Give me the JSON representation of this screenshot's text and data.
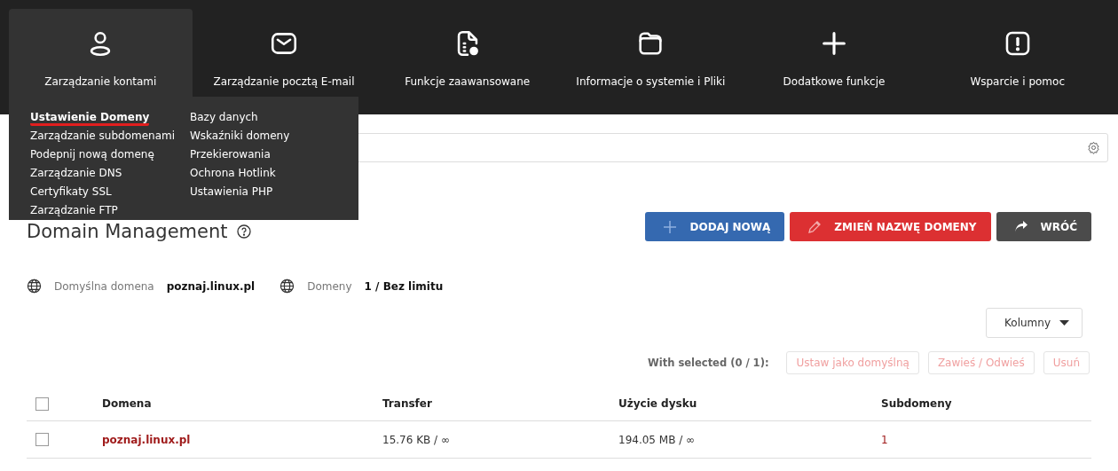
{
  "nav": [
    {
      "label": "Zarządzanie kontami",
      "selected": true
    },
    {
      "label": "Zarządzanie pocztą E-mail",
      "selected": false
    },
    {
      "label": "Funkcje zaawansowane",
      "selected": false
    },
    {
      "label": "Informacje o systemie i Pliki",
      "selected": false
    },
    {
      "label": "Dodatkowe funkcje",
      "selected": false
    },
    {
      "label": "Wsparcie i pomoc",
      "selected": false
    }
  ],
  "menu": {
    "columns": [
      [
        {
          "label": "Ustawienie Domeny",
          "selected": true
        },
        {
          "label": "Zarządzanie subdomenami",
          "selected": false
        },
        {
          "label": "Podepnij nową domenę",
          "selected": false
        },
        {
          "label": "Zarządzanie DNS",
          "selected": false
        },
        {
          "label": "Certyfikaty SSL",
          "selected": false
        },
        {
          "label": "Zarządzanie FTP",
          "selected": false
        }
      ],
      [
        {
          "label": "Bazy danych",
          "selected": false
        },
        {
          "label": "Wskaźniki domeny",
          "selected": false
        },
        {
          "label": "Przekierowania",
          "selected": false
        },
        {
          "label": "Ochrona Hotlink",
          "selected": false
        },
        {
          "label": "Ustawienia PHP",
          "selected": false
        }
      ]
    ]
  },
  "title": "Domain Management",
  "actions": [
    {
      "label": "DODAJ NOWĄ",
      "kind": "add"
    },
    {
      "label": "ZMIEŃ NAZWĘ DOMENY",
      "kind": "rename"
    },
    {
      "label": "WRÓĆ",
      "kind": "back"
    }
  ],
  "stats": [
    {
      "label": "Domyślna domena",
      "value": "poznaj.linux.pl"
    },
    {
      "label": "Domeny",
      "value": "1 / Bez limitu"
    }
  ],
  "columns_button": "Kolumny",
  "bulk": {
    "label": "With selected (0 / 1):",
    "actions": [
      {
        "label": "Ustaw jako domyślną",
        "disabled": true
      },
      {
        "label": "Zawieś / Odwieś",
        "disabled": true
      },
      {
        "label": "Usuń",
        "disabled": true
      }
    ]
  },
  "table": {
    "header_checked": false,
    "columns": [
      "Domena",
      "Transfer",
      "Użycie dysku",
      "Subdomeny"
    ],
    "rows": [
      {
        "checked": false,
        "cells": [
          "poznaj.linux.pl",
          "15.76 KB / ∞",
          "194.05 MB / ∞",
          "1"
        ]
      }
    ]
  }
}
